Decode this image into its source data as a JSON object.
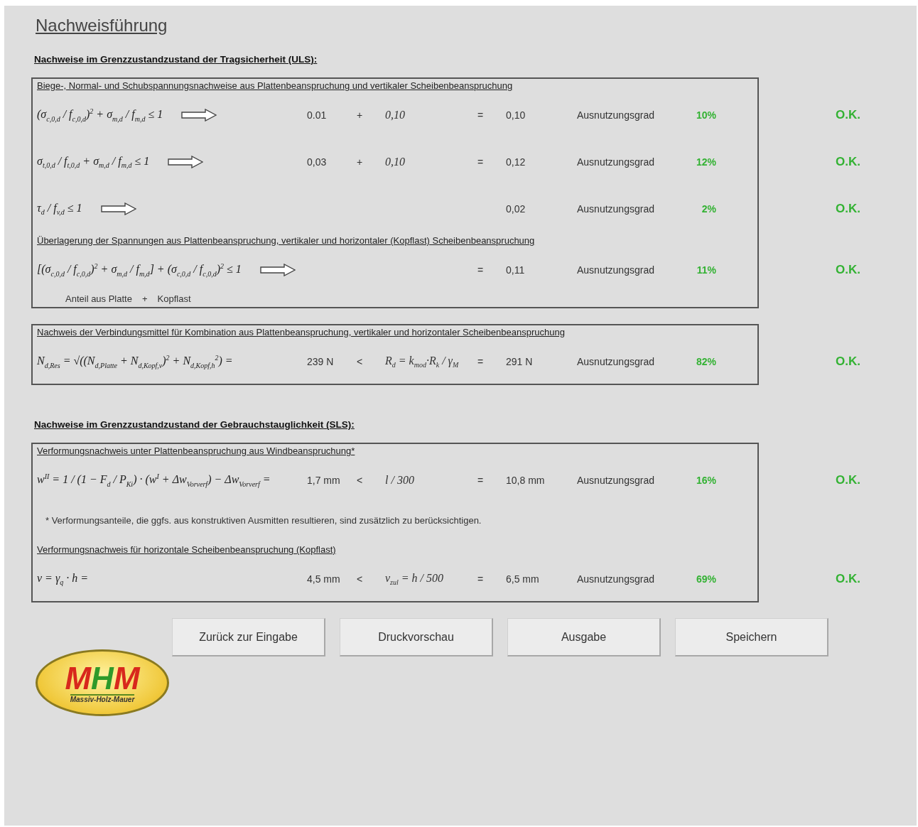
{
  "title": "Nachweisführung",
  "sections": [
    {
      "heading": "Nachweise im Grenzzustandzustand der Tragsicherheit  (ULS):",
      "panels": [
        {
          "items": [
            {
              "kind": "subheading",
              "text": "Biege-, Normal- und Schubspannungsnachweise aus Plattenbeanspruchung und vertikaler Scheibenbeanspruchung"
            },
            {
              "kind": "check",
              "formula": "(σ$_{c,0,d}$ / f$_{c,0,d}$)$^{2}$ + σ$_{m,d}$ / f$_{m,d}$ ≤ 1",
              "arrow": true,
              "cells": [
                "0.01",
                "+",
                "0,10",
                "=",
                "0,10"
              ],
              "label": "Ausnutzungsgrad",
              "percent": "10%",
              "status": "O.K.",
              "passed": true
            },
            {
              "kind": "check",
              "formula": "σ$_{t,0,d}$ / f$_{t,0,d}$ + σ$_{m,d}$ / f$_{m,d}$ ≤ 1",
              "arrow": true,
              "cells": [
                "0,03",
                "+",
                "0,10",
                "=",
                "0,12"
              ],
              "label": "Ausnutzungsgrad",
              "percent": "12%",
              "status": "O.K.",
              "passed": true
            },
            {
              "kind": "check",
              "formula": "τ$_{d}$ / f$_{v,d}$ ≤ 1",
              "arrow": true,
              "cells": [
                null,
                null,
                null,
                null,
                "0,02"
              ],
              "label": "Ausnutzungsgrad",
              "percent": "2%",
              "status": "O.K.",
              "passed": true
            },
            {
              "kind": "subheading",
              "text": "Überlagerung der Spannungen aus Plattenbeanspruchung, vertikaler und horizontaler (Kopflast) Scheibenbeanspruchung"
            },
            {
              "kind": "check",
              "formula": "[(σ$_{c,0,d}$ / f$_{c,0,d}$)$^{2}$ + σ$_{m,d}$ / f$_{m,d}$] + (σ$_{c,0,d}$ / f$_{c,0,d}$)$^{2}$ ≤ 1",
              "arrow": true,
              "cells": [
                null,
                null,
                null,
                "=",
                "0,11"
              ],
              "label": "Ausnutzungsgrad",
              "percent": "11%",
              "status": "O.K.",
              "passed": true
            },
            {
              "kind": "caption",
              "parts": [
                "Anteil aus Platte",
                "+",
                "Kopflast"
              ]
            }
          ]
        },
        {
          "items": [
            {
              "kind": "subheading",
              "text": "Nachweis der Verbindungsmittel für Kombination aus Plattenbeanspruchung, vertikaler und horizontaler Scheibenbeanspruchung"
            },
            {
              "kind": "check",
              "formula": "N$_{d,Res}$ = √((N$_{d,Platte}$ + N$_{d,Kopf,v}$)$^{2}$ + N$_{d,Kopf,h}$$^{2}$) =",
              "arrow": false,
              "cells": [
                "239 N",
                "<",
                "R$_{d}$ = k$_{mod}$·R$_{k}$ / γ$_{M}$",
                "=",
                "291 N"
              ],
              "label": "Ausnutzungsgrad",
              "percent": "82%",
              "status": "O.K.",
              "passed": true
            }
          ]
        }
      ]
    },
    {
      "heading": "Nachweise im Grenzzustandzustand der Gebrauchstauglichkeit  (SLS):",
      "panels": [
        {
          "items": [
            {
              "kind": "subheading",
              "text": "Verformungsnachweis unter Plattenbeanspruchung aus Windbeanspruchung*"
            },
            {
              "kind": "check",
              "formula": "w$^{II}$ = 1 / (1 − F$_{d}$ / P$_{Ki}$) · (w$^{I}$ + Δw$_{Vorverf}$) − Δw$_{Vorverf}$ =",
              "arrow": false,
              "cells": [
                "1,7 mm",
                "<",
                "l / 300",
                "=",
                "10,8 mm"
              ],
              "label": "Ausnutzungsgrad",
              "percent": "16%",
              "status": "O.K.",
              "passed": true
            },
            {
              "kind": "note",
              "text": "* Verformungsanteile, die ggfs. aus konstruktiven Ausmitten resultieren, sind zusätzlich zu berücksichtigen."
            },
            {
              "kind": "subheading",
              "text": "Verformungsnachweis für horizontale Scheibenbeanspruchung (Kopflast)"
            },
            {
              "kind": "check",
              "formula": "v = γ$_{q}$ · h   =",
              "arrow": false,
              "cells": [
                "4,5 mm",
                "<",
                "v$_{zul}$ = h / 500",
                "=",
                "6,5 mm"
              ],
              "label": "Ausnutzungsgrad",
              "percent": "69%",
              "status": "O.K.",
              "passed": true
            }
          ]
        }
      ]
    }
  ],
  "buttons": [
    "Zurück zur Eingabe",
    "Druckvorschau",
    "Ausgabe",
    "Speichern"
  ],
  "logo": {
    "letters": [
      {
        "text": "M",
        "color": "#d8281c"
      },
      {
        "text": "H",
        "color": "#2f9a2a"
      },
      {
        "text": "M",
        "color": "#d8281c"
      }
    ],
    "tagline": "Massiv-Holz-Mauer"
  }
}
